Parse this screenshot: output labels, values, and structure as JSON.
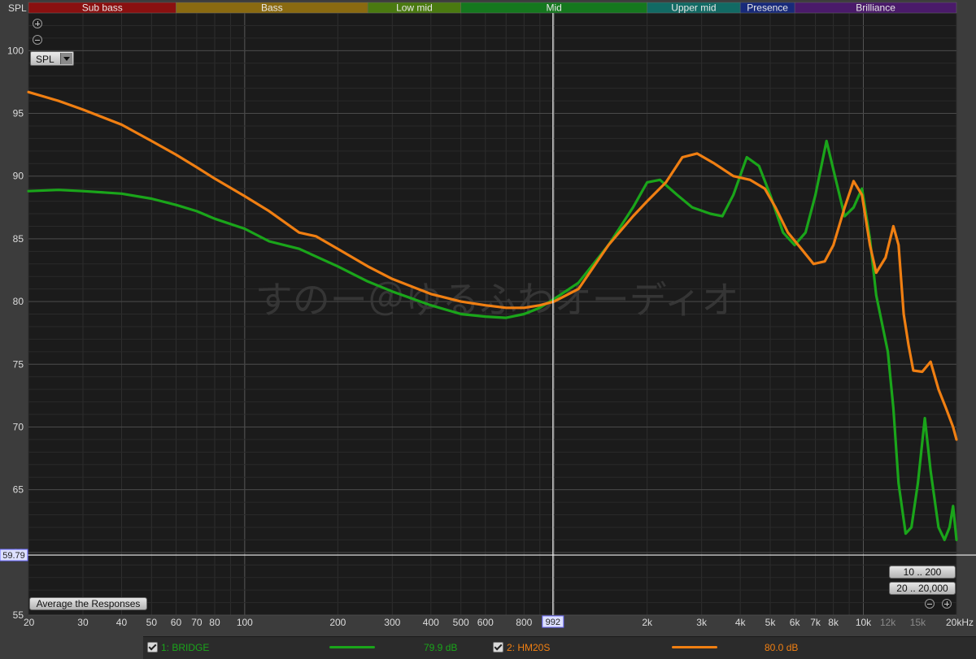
{
  "chart_data": {
    "type": "line",
    "ylabel": "SPL",
    "ylim": [
      55,
      103
    ],
    "xlim": [
      20,
      20000
    ],
    "x_scale": "log",
    "grid": true,
    "y_ticks": [
      55,
      60,
      65,
      70,
      75,
      80,
      85,
      90,
      95,
      100
    ],
    "x_ticks": [
      {
        "v": 20,
        "label": "20"
      },
      {
        "v": 30,
        "label": "30"
      },
      {
        "v": 40,
        "label": "40"
      },
      {
        "v": 50,
        "label": "50"
      },
      {
        "v": 60,
        "label": "60"
      },
      {
        "v": 70,
        "label": "70"
      },
      {
        "v": 80,
        "label": "80"
      },
      {
        "v": 100,
        "label": "100"
      },
      {
        "v": 200,
        "label": "200"
      },
      {
        "v": 300,
        "label": "300"
      },
      {
        "v": 400,
        "label": "400"
      },
      {
        "v": 500,
        "label": "500"
      },
      {
        "v": 600,
        "label": "600"
      },
      {
        "v": 800,
        "label": "800"
      },
      {
        "v": 2000,
        "label": "2k"
      },
      {
        "v": 3000,
        "label": "3k"
      },
      {
        "v": 4000,
        "label": "4k"
      },
      {
        "v": 5000,
        "label": "5k"
      },
      {
        "v": 6000,
        "label": "6k"
      },
      {
        "v": 7000,
        "label": "7k"
      },
      {
        "v": 8000,
        "label": "8k"
      },
      {
        "v": 10000,
        "label": "10k"
      },
      {
        "v": 12000,
        "label": "12k",
        "dim": true
      },
      {
        "v": 15000,
        "label": "15k",
        "dim": true
      },
      {
        "v": 20000,
        "label": "20kHz"
      }
    ],
    "bands": [
      {
        "name": "Sub bass",
        "from": 20,
        "to": 60,
        "color": "#8a1010"
      },
      {
        "name": "Bass",
        "from": 60,
        "to": 250,
        "color": "#8a6a10"
      },
      {
        "name": "Low mid",
        "from": 250,
        "to": 500,
        "color": "#4a7a10"
      },
      {
        "name": "Mid",
        "from": 500,
        "to": 2000,
        "color": "#15781e"
      },
      {
        "name": "Upper mid",
        "from": 2000,
        "to": 4000,
        "color": "#126a64"
      },
      {
        "name": "Presence",
        "from": 4000,
        "to": 6000,
        "color": "#182a7a"
      },
      {
        "name": "Brilliance",
        "from": 6000,
        "to": 20000,
        "color": "#4a1a6a"
      }
    ],
    "cursor": {
      "x": 992,
      "x_label": "992",
      "y": 59.79,
      "y_label": "59.79"
    },
    "watermark": "すのー＠ゆるふわオーディオ",
    "series": [
      {
        "name": "1: BRIDGE",
        "color": "#1aa51a",
        "points": [
          [
            20,
            88.8
          ],
          [
            25,
            88.9
          ],
          [
            30,
            88.8
          ],
          [
            40,
            88.6
          ],
          [
            50,
            88.2
          ],
          [
            60,
            87.7
          ],
          [
            70,
            87.2
          ],
          [
            80,
            86.6
          ],
          [
            100,
            85.8
          ],
          [
            120,
            84.8
          ],
          [
            150,
            84.2
          ],
          [
            200,
            82.8
          ],
          [
            250,
            81.6
          ],
          [
            300,
            80.8
          ],
          [
            400,
            79.7
          ],
          [
            500,
            79.0
          ],
          [
            600,
            78.8
          ],
          [
            700,
            78.7
          ],
          [
            800,
            79.0
          ],
          [
            900,
            79.5
          ],
          [
            1000,
            80.2
          ],
          [
            1200,
            81.5
          ],
          [
            1500,
            84.5
          ],
          [
            1800,
            87.5
          ],
          [
            2000,
            89.5
          ],
          [
            2200,
            89.7
          ],
          [
            2500,
            88.5
          ],
          [
            2800,
            87.5
          ],
          [
            3200,
            87.0
          ],
          [
            3500,
            86.8
          ],
          [
            3800,
            88.5
          ],
          [
            4200,
            91.5
          ],
          [
            4600,
            90.8
          ],
          [
            5000,
            88.5
          ],
          [
            5500,
            85.5
          ],
          [
            6000,
            84.5
          ],
          [
            6500,
            85.5
          ],
          [
            7000,
            88.5
          ],
          [
            7600,
            92.8
          ],
          [
            8000,
            90.5
          ],
          [
            8700,
            86.8
          ],
          [
            9300,
            87.5
          ],
          [
            9900,
            89.0
          ],
          [
            10500,
            85.0
          ],
          [
            11000,
            80.5
          ],
          [
            12000,
            76.0
          ],
          [
            12500,
            71.5
          ],
          [
            13000,
            65.5
          ],
          [
            13700,
            61.5
          ],
          [
            14300,
            62.0
          ],
          [
            15000,
            65.5
          ],
          [
            15800,
            70.7
          ],
          [
            16500,
            66.5
          ],
          [
            17500,
            62.0
          ],
          [
            18300,
            61.0
          ],
          [
            19000,
            62.0
          ],
          [
            19500,
            63.7
          ],
          [
            20000,
            61.0
          ]
        ]
      },
      {
        "name": "2: HM20S",
        "color": "#f07f12",
        "points": [
          [
            20,
            96.7
          ],
          [
            22,
            96.4
          ],
          [
            25,
            96.0
          ],
          [
            30,
            95.3
          ],
          [
            40,
            94.1
          ],
          [
            50,
            92.8
          ],
          [
            60,
            91.7
          ],
          [
            70,
            90.7
          ],
          [
            80,
            89.8
          ],
          [
            100,
            88.4
          ],
          [
            120,
            87.2
          ],
          [
            150,
            85.5
          ],
          [
            170,
            85.2
          ],
          [
            200,
            84.2
          ],
          [
            250,
            82.8
          ],
          [
            300,
            81.8
          ],
          [
            400,
            80.6
          ],
          [
            500,
            80.0
          ],
          [
            600,
            79.7
          ],
          [
            700,
            79.5
          ],
          [
            800,
            79.5
          ],
          [
            900,
            79.7
          ],
          [
            1000,
            80.0
          ],
          [
            1200,
            81.0
          ],
          [
            1500,
            84.5
          ],
          [
            1800,
            86.8
          ],
          [
            2000,
            88.0
          ],
          [
            2300,
            89.5
          ],
          [
            2600,
            91.5
          ],
          [
            2900,
            91.8
          ],
          [
            3300,
            91.0
          ],
          [
            3800,
            90.0
          ],
          [
            4300,
            89.7
          ],
          [
            4800,
            89.0
          ],
          [
            5200,
            87.5
          ],
          [
            5700,
            85.5
          ],
          [
            6300,
            84.2
          ],
          [
            6900,
            83.0
          ],
          [
            7500,
            83.2
          ],
          [
            8000,
            84.5
          ],
          [
            8700,
            87.5
          ],
          [
            9300,
            89.6
          ],
          [
            9900,
            88.5
          ],
          [
            10500,
            84.5
          ],
          [
            11000,
            82.3
          ],
          [
            11800,
            83.5
          ],
          [
            12500,
            86.0
          ],
          [
            13000,
            84.5
          ],
          [
            13500,
            79.0
          ],
          [
            14000,
            76.5
          ],
          [
            14500,
            74.5
          ],
          [
            15500,
            74.4
          ],
          [
            16500,
            75.2
          ],
          [
            17500,
            73.0
          ],
          [
            18500,
            71.5
          ],
          [
            19500,
            70.0
          ],
          [
            20000,
            69.0
          ]
        ]
      }
    ]
  },
  "toolbar": {
    "spl_select_value": "SPL",
    "average_button": "Average the Responses",
    "range_button_1": "10 .. 200",
    "range_button_2": "20 .. 20,000"
  },
  "legend": [
    {
      "name": "1: BRIDGE",
      "value": "79.9 dB",
      "color": "#1aa51a"
    },
    {
      "name": "2: HM20S",
      "value": "80.0 dB",
      "color": "#f07f12"
    }
  ]
}
